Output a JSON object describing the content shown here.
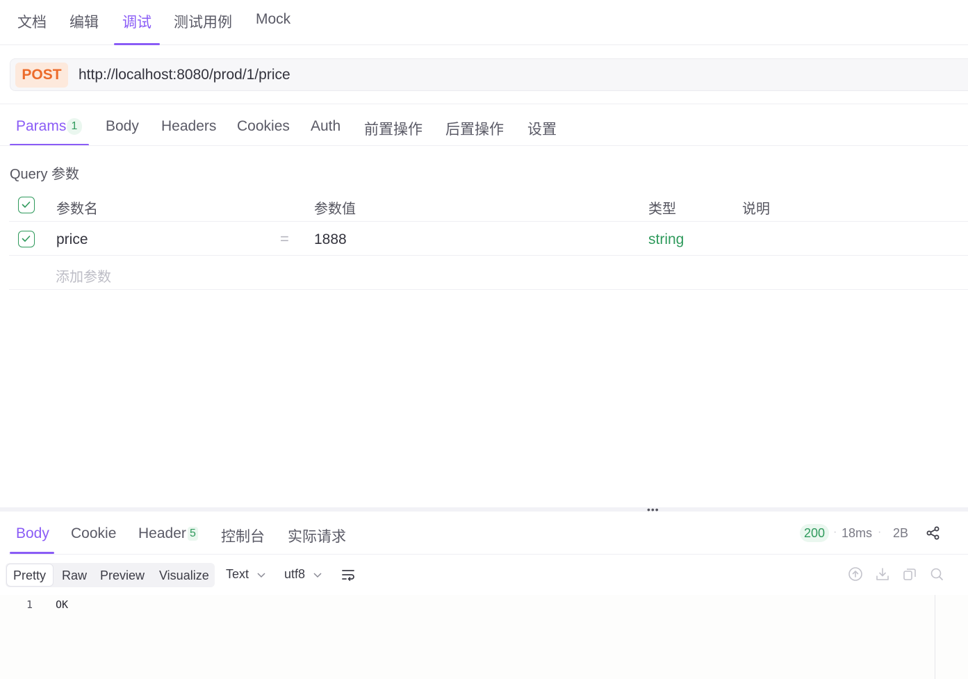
{
  "top_tabs": [
    {
      "label": "文档"
    },
    {
      "label": "编辑"
    },
    {
      "label": "调试"
    },
    {
      "label": "测试用例"
    },
    {
      "label": "Mock"
    }
  ],
  "active_top_tab": "调试",
  "request": {
    "method": "POST",
    "url": "http://localhost:8080/prod/1/price"
  },
  "request_tabs": [
    {
      "label": "Params"
    },
    {
      "label": "Body"
    },
    {
      "label": "Headers"
    },
    {
      "label": "Cookies"
    },
    {
      "label": "Auth"
    },
    {
      "label": "前置操作"
    },
    {
      "label": "后置操作"
    },
    {
      "label": "设置"
    }
  ],
  "params_count": "1",
  "query": {
    "title": "Query 参数",
    "columns": [
      "参数名",
      "参数值",
      "类型",
      "说明"
    ],
    "rows": [
      {
        "name": "price",
        "separator": "=",
        "value": "1888",
        "type": "string",
        "description": "",
        "checked": true
      }
    ],
    "add_placeholder": "添加参数"
  },
  "response": {
    "tabs": [
      {
        "label": "Body"
      },
      {
        "label": "Cookie"
      },
      {
        "label": "Header"
      },
      {
        "label": "控制台"
      },
      {
        "label": "实际请求"
      }
    ],
    "header_count": "5",
    "status": "200",
    "time": "18ms",
    "size": "2B",
    "view_modes": [
      "Pretty",
      "Raw",
      "Preview",
      "Visualize"
    ],
    "active_view_mode": "Pretty",
    "format": "Text",
    "encoding": "utf8",
    "lines": [
      {
        "no": "1",
        "text": "OK"
      }
    ]
  },
  "colors": {
    "accent": "#8a5cf6",
    "method_post": "#ec6b2b",
    "success": "#2f9a5c"
  },
  "icons": [
    "check-icon",
    "share-icon",
    "wrap-lines-icon",
    "chevron-down-icon",
    "upload-icon",
    "download-icon",
    "copy-icon",
    "search-icon"
  ]
}
